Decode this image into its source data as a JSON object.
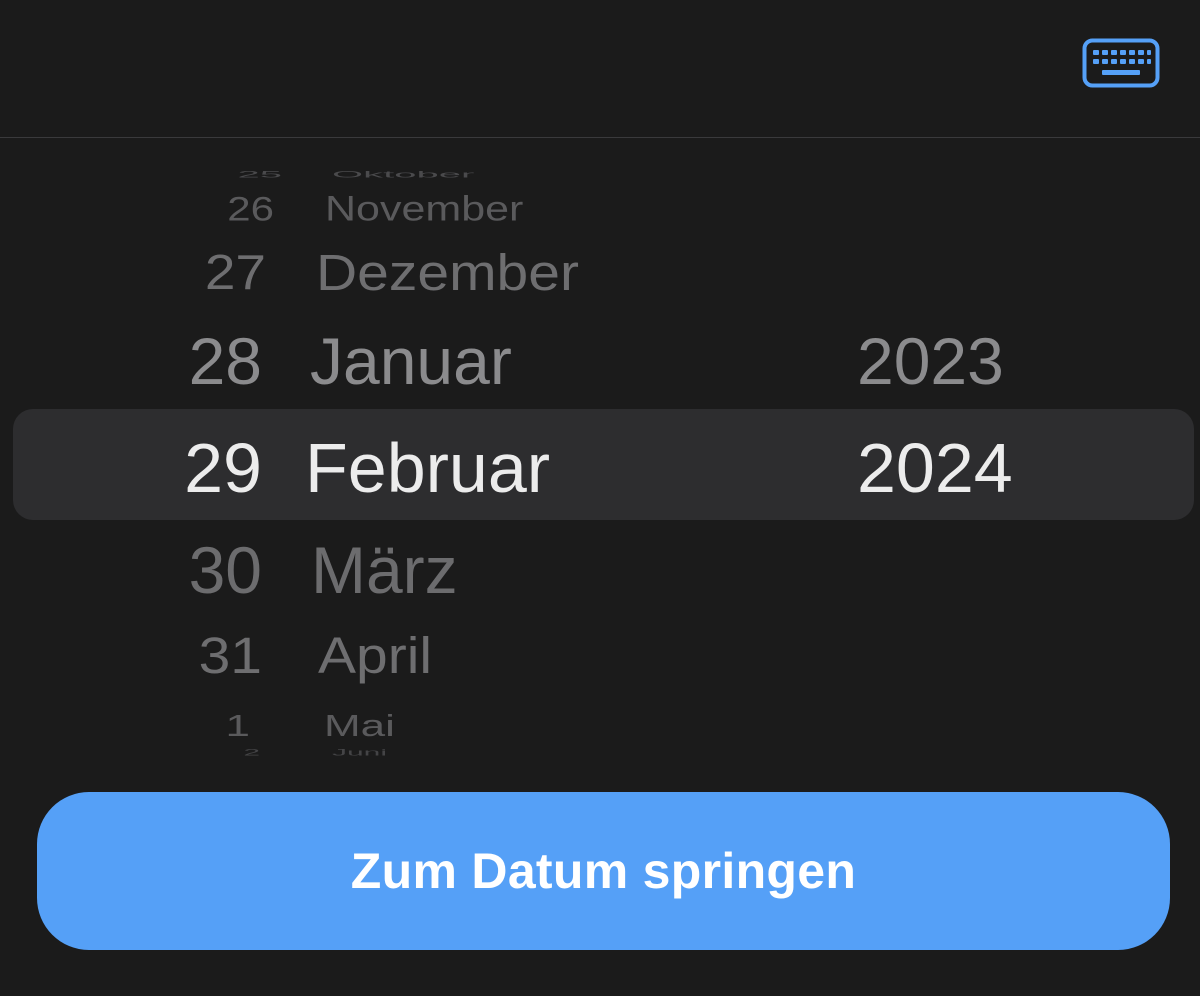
{
  "accent_color": "#55a0f7",
  "toolbar": {
    "keyboard_icon": "keyboard-icon"
  },
  "picker": {
    "days": [
      "25",
      "26",
      "27",
      "28",
      "29",
      "30",
      "31",
      "1",
      "2"
    ],
    "months": [
      "Oktober",
      "November",
      "Dezember",
      "Januar",
      "Februar",
      "März",
      "April",
      "Mai",
      "Juni"
    ],
    "years": [
      "2023",
      "2024"
    ],
    "selected": {
      "day": "29",
      "month": "Februar",
      "year": "2024"
    }
  },
  "action": {
    "label": "Zum Datum springen"
  }
}
